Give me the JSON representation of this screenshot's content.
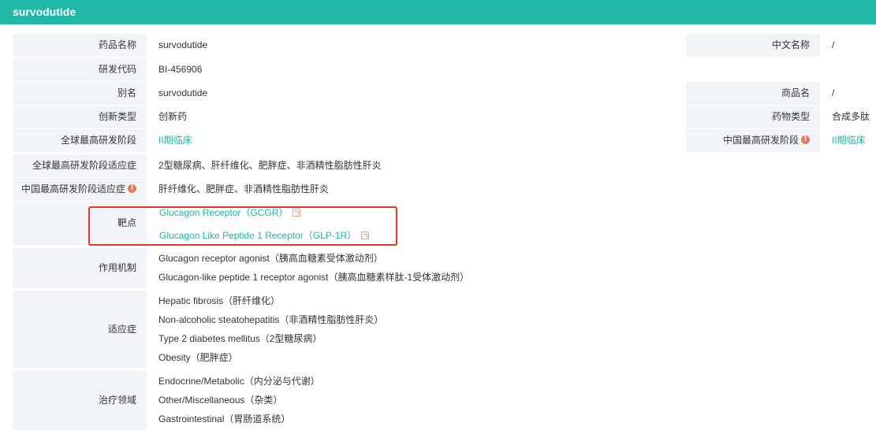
{
  "header": {
    "title": "survodutide"
  },
  "fields": {
    "drug_name": {
      "label": "药品名称",
      "value": "survodutide"
    },
    "chinese_name": {
      "label": "中文名称",
      "value": "/"
    },
    "dev_code": {
      "label": "研发代码",
      "value": "BI-456906"
    },
    "alias": {
      "label": "别名",
      "value": "survodutide"
    },
    "trade_name": {
      "label": "商品名",
      "value": "/"
    },
    "innovation_type": {
      "label": "创新类型",
      "value": "创新药"
    },
    "drug_type": {
      "label": "药物类型",
      "value": "合成多肽"
    },
    "global_phase": {
      "label": "全球最高研发阶段",
      "value": "II期临床"
    },
    "china_phase": {
      "label": "中国最高研发阶段",
      "value": "II期临床"
    },
    "global_indication": {
      "label": "全球最高研发阶段适应症",
      "value": "2型糖尿病、肝纤维化、肥胖症、非酒精性脂肪性肝炎"
    },
    "china_indication": {
      "label": "中国最高研发阶段适应症",
      "value": "肝纤维化、肥胖症、非酒精性脂肪性肝炎"
    }
  },
  "targets": {
    "label": "靶点",
    "items": [
      "Glucagon Receptor（GCGR）",
      "Glucagon Like Peptide 1 Receptor（GLP-1R）"
    ]
  },
  "mechanism": {
    "label": "作用机制",
    "items": [
      "Glucagon receptor agonist（胰高血糖素受体激动剂）",
      "Glucagon-like peptide 1 receptor agonist（胰高血糖素样肽-1受体激动剂）"
    ]
  },
  "indications": {
    "label": "适应症",
    "items": [
      "Hepatic fibrosis（肝纤维化）",
      "Non-alcoholic steatohepatitis（非酒精性脂肪性肝炎）",
      "Type 2 diabetes mellitus（2型糖尿病）",
      "Obesity（肥胖症）"
    ]
  },
  "therapeutic_area": {
    "label": "治疗领域",
    "items": [
      "Endocrine/Metabolic（内分泌与代谢）",
      "Other/Miscellaneous（杂类）",
      "Gastrointestinal（胃肠道系统）"
    ]
  },
  "icons": {
    "info": "info-icon",
    "external_link": "external-link-icon"
  },
  "colors": {
    "accent": "#1fb7a6",
    "highlight": "#e8352a",
    "label_bg": "#f2f5f8"
  }
}
